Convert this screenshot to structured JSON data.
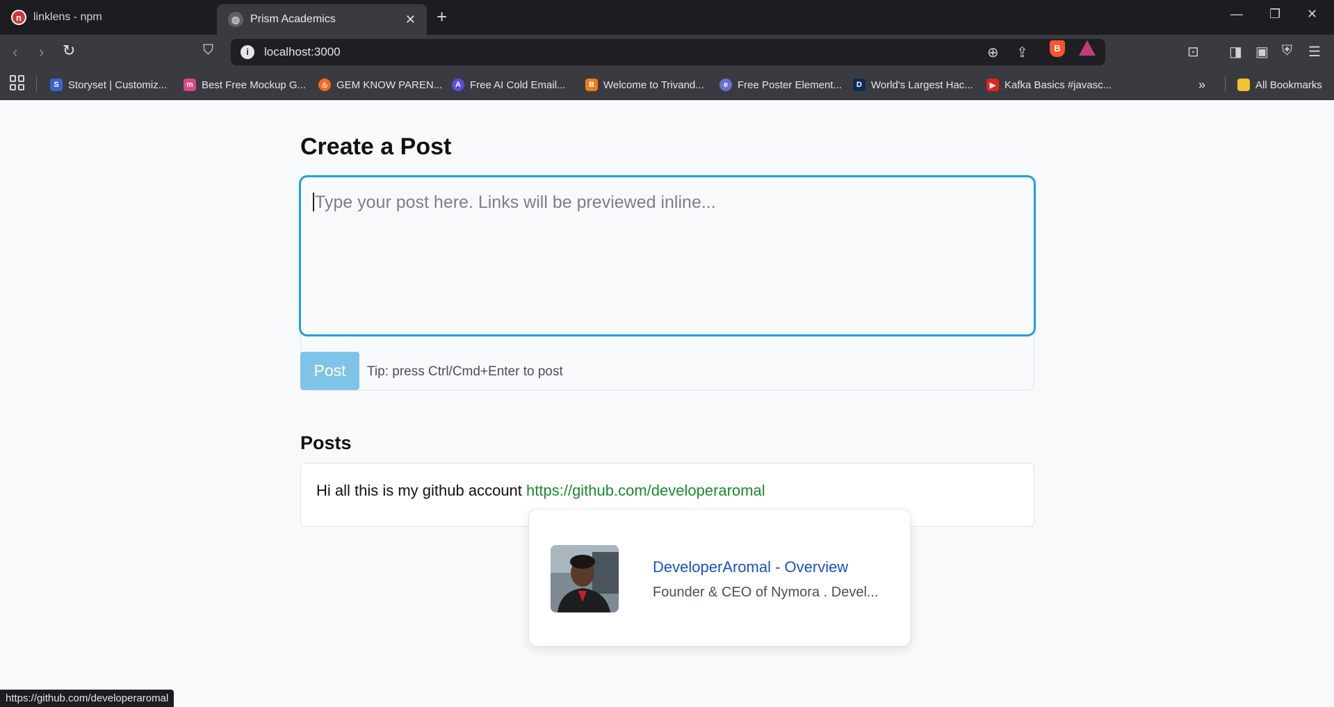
{
  "browser": {
    "tabs": [
      {
        "title": "linklens - npm"
      },
      {
        "title": "Prism Academics"
      }
    ],
    "address": "localhost:3000",
    "bookmarks": [
      {
        "label": "Storyset | Customiz...",
        "color": "#3c64c8"
      },
      {
        "label": "Best Free Mockup G...",
        "color": "#e0458a"
      },
      {
        "label": "GEM KNOW PAREN...",
        "color": "#f26a1b"
      },
      {
        "label": "Free AI Cold Email...",
        "color": "#5a4fe0"
      },
      {
        "label": "Welcome to Trivand...",
        "color": "#f27a1a"
      },
      {
        "label": "Free Poster Element...",
        "color": "#6b6fd0"
      },
      {
        "label": "World's Largest Hac...",
        "color": "#0b2a55"
      },
      {
        "label": "Kafka Basics #javasc...",
        "color": "#e8201b"
      }
    ],
    "all_bookmarks": "All Bookmarks",
    "status_url": "https://github.com/developeraromal"
  },
  "page": {
    "title": "Create a Post",
    "composer_placeholder": "Type your post here. Links will be previewed inline...",
    "post_button": "Post",
    "tip": "Tip: press Ctrl/Cmd+Enter to post",
    "posts_heading": "Posts",
    "posts": [
      {
        "text": "Hi all this is my github account ",
        "link": "https://github.com/developeraromal"
      }
    ]
  },
  "link_preview": {
    "title": "DeveloperAromal - Overview",
    "description": "Founder & CEO of Nymora . Devel..."
  }
}
